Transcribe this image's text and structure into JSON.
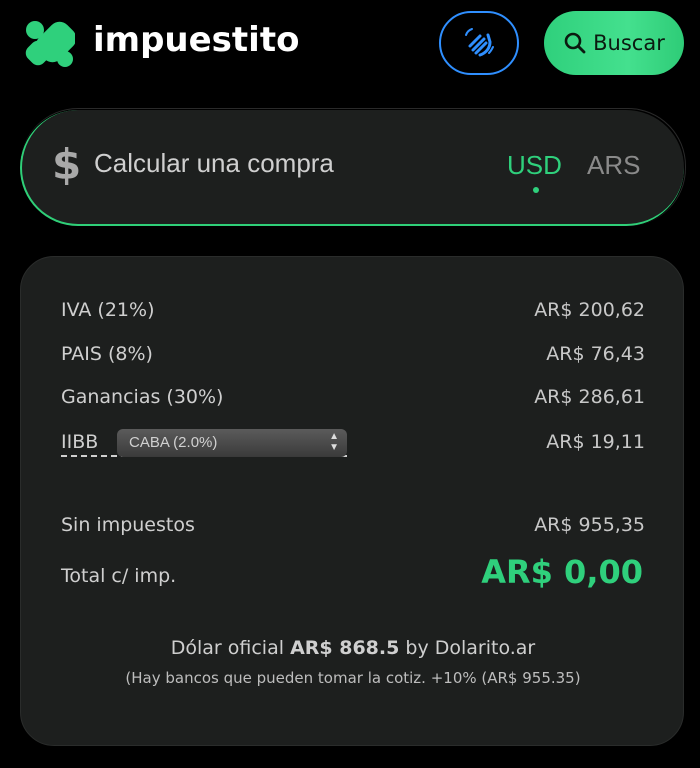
{
  "header": {
    "brand": "impuestito",
    "search_label": "Buscar",
    "wave_icon": "waving-hand-icon",
    "search_icon": "search-icon"
  },
  "calc": {
    "label": "Calcular una compra",
    "currency_selected": "USD",
    "currency_other": "ARS"
  },
  "breakdown": {
    "iva": {
      "label": "IVA (21%)",
      "value": "AR$ 200,62"
    },
    "pais": {
      "label": "PAIS (8%)",
      "value": "AR$ 76,43"
    },
    "ganancias": {
      "label": "Ganancias (30%)",
      "value": "AR$ 286,61"
    },
    "iibb": {
      "label": "IIBB",
      "select_value": "CABA (2.0%)",
      "value": "AR$ 19,11"
    },
    "sin_impuestos": {
      "label": "Sin impuestos",
      "value": "AR$ 955,35"
    },
    "total": {
      "label": "Total c/ imp.",
      "value": "AR$ 0,00"
    }
  },
  "footer": {
    "dolar_prefix": "Dólar oficial",
    "dolar_value": "AR$ 868.5",
    "dolar_suffix": "by Dolarito.ar",
    "note": "(Hay bancos que pueden tomar la cotiz. +10% (AR$ 955.35)"
  },
  "colors": {
    "accent_green": "#2fd07c",
    "accent_blue": "#2f8fff",
    "card_bg": "#1d1f1e"
  }
}
